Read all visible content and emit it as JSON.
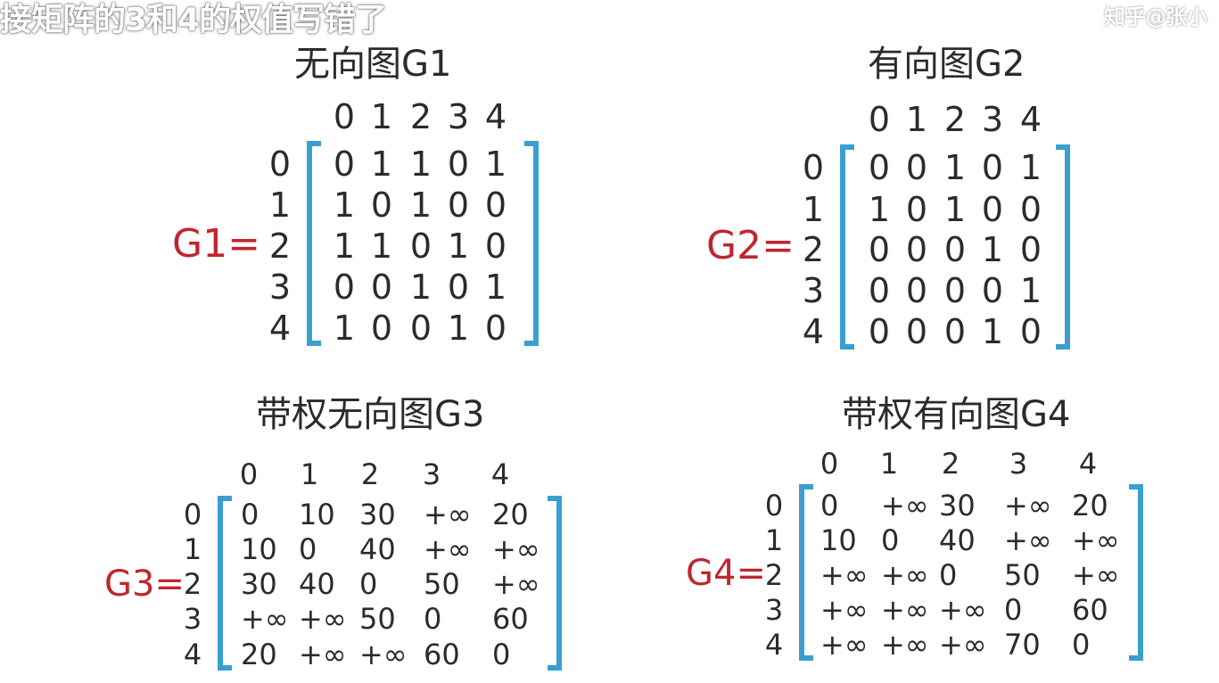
{
  "caption": "接矩阵的3和4的权值写错了",
  "watermark": "知乎@张小",
  "colors": {
    "bracket": "#3a9fd0",
    "label": "#c0262e",
    "text": "#2b2b2b"
  },
  "g1": {
    "title": "无向图G1",
    "label": "G1=",
    "cols": [
      "0",
      "1",
      "2",
      "3",
      "4"
    ],
    "rows": [
      {
        "idx": "0",
        "cells": [
          "0",
          "1",
          "1",
          "0",
          "1"
        ]
      },
      {
        "idx": "1",
        "cells": [
          "1",
          "0",
          "1",
          "0",
          "0"
        ]
      },
      {
        "idx": "2",
        "cells": [
          "1",
          "1",
          "0",
          "1",
          "0"
        ]
      },
      {
        "idx": "3",
        "cells": [
          "0",
          "0",
          "1",
          "0",
          "1"
        ]
      },
      {
        "idx": "4",
        "cells": [
          "1",
          "0",
          "0",
          "1",
          "0"
        ]
      }
    ]
  },
  "g2": {
    "title": "有向图G2",
    "label": "G2=",
    "cols": [
      "0",
      "1",
      "2",
      "3",
      "4"
    ],
    "rows": [
      {
        "idx": "0",
        "cells": [
          "0",
          "0",
          "1",
          "0",
          "1"
        ]
      },
      {
        "idx": "1",
        "cells": [
          "1",
          "0",
          "1",
          "0",
          "0"
        ]
      },
      {
        "idx": "2",
        "cells": [
          "0",
          "0",
          "0",
          "1",
          "0"
        ]
      },
      {
        "idx": "3",
        "cells": [
          "0",
          "0",
          "0",
          "0",
          "1"
        ]
      },
      {
        "idx": "4",
        "cells": [
          "0",
          "0",
          "0",
          "1",
          "0"
        ]
      }
    ]
  },
  "g3": {
    "title": "带权无向图G3",
    "label": "G3=",
    "cols": [
      "0",
      "1",
      "2",
      "3",
      "4"
    ],
    "rows": [
      {
        "idx": "0",
        "cells": [
          "0",
          "10",
          "30",
          "+∞",
          "20"
        ]
      },
      {
        "idx": "1",
        "cells": [
          "10",
          "0",
          "40",
          "+∞",
          "+∞"
        ]
      },
      {
        "idx": "2",
        "cells": [
          "30",
          "40",
          "0",
          "50",
          "+∞"
        ]
      },
      {
        "idx": "3",
        "cells": [
          "+∞",
          "+∞",
          "50",
          "0",
          "60"
        ]
      },
      {
        "idx": "4",
        "cells": [
          "20",
          "+∞",
          "+∞",
          "60",
          "0"
        ]
      }
    ]
  },
  "g4": {
    "title": "带权有向图G4",
    "label": "G4=",
    "cols": [
      "0",
      "1",
      "2",
      "3",
      "4"
    ],
    "rows": [
      {
        "idx": "0",
        "cells": [
          "0",
          "+∞",
          "30",
          "+∞",
          "20"
        ]
      },
      {
        "idx": "1",
        "cells": [
          "10",
          "0",
          "40",
          "+∞",
          "+∞"
        ]
      },
      {
        "idx": "2",
        "cells": [
          "+∞",
          "+∞",
          "0",
          "50",
          "+∞"
        ]
      },
      {
        "idx": "3",
        "cells": [
          "+∞",
          "+∞",
          "+∞",
          "0",
          "60"
        ]
      },
      {
        "idx": "4",
        "cells": [
          "+∞",
          "+∞",
          "+∞",
          "70",
          "0"
        ]
      }
    ]
  }
}
